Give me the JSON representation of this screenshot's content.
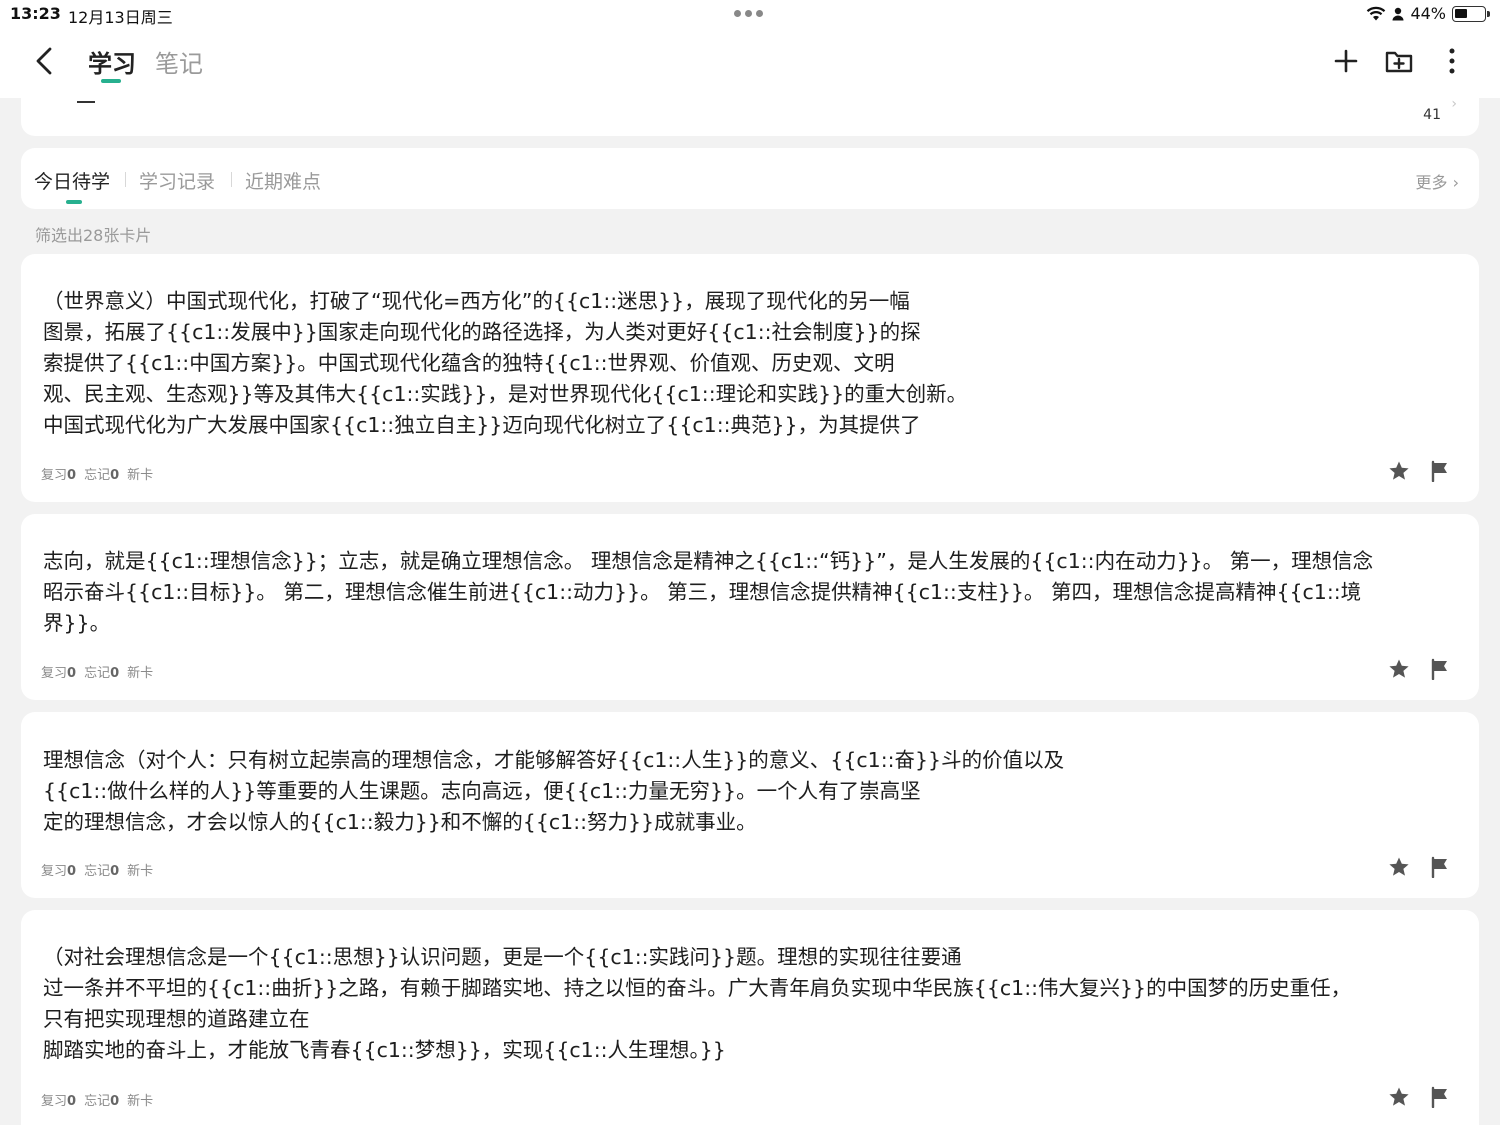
{
  "status_bar": {
    "time": "13:23",
    "date": "12月13日周三",
    "battery": "44%",
    "battery_level": 0.44
  },
  "header": {
    "tab_active": "学习",
    "tab_inactive": "笔记",
    "icons": [
      "back-icon",
      "plus-icon",
      "add-folder-icon",
      "more-vertical-icon"
    ]
  },
  "top_card": {
    "count": "41"
  },
  "segments": {
    "tabs": [
      "今日待学",
      "学习记录",
      "近期难点"
    ],
    "more": "更多 ›"
  },
  "filter_text": "筛选出28张卡片",
  "cards": [
    {
      "text": "（世界意义）中国式现代化，打破了“现代化=西方化”的{{c1::迷思}}，展现了现代化的另一幅\n图景，拓展了{{c1::发展中}}国家走向现代化的路径选择，为人类对更好{{c1::社会制度}}的探\n索提供了{{c1::中国方案}}。中国式现代化蕴含的独特{{c1::世界观、价值观、历史观、文明\n观、民主观、生态观}}等及其伟大{{c1::实践}}，是对世界现代化{{c1::理论和实践}}的重大创新。\n中国式现代化为广大发展中国家{{c1::独立自主}}迈向现代化树立了{{c1::典范}}，为其提供了",
      "review_label": "复习",
      "review_count": "0",
      "forget_label": "忘记",
      "forget_count": "0",
      "status": "新卡"
    },
    {
      "text": "志向，就是{{c1::理想信念}}；立志，就是确立理想信念。 理想信念是精神之{{c1::“钙}}”，是人生发展的{{c1::内在动力}}。 第一，理想信念\n昭示奋斗{{c1::目标}}。 第二，理想信念催生前进{{c1::动力}}。 第三，理想信念提供精神{{c1::支柱}}。 第四，理想信念提高精神{{c1::境\n界}}。",
      "review_label": "复习",
      "review_count": "0",
      "forget_label": "忘记",
      "forget_count": "0",
      "status": "新卡"
    },
    {
      "text": "理想信念（对个人：只有树立起崇高的理想信念，才能够解答好{{c1::人生}}的意义、{{c1::奋}}斗的价值以及\n{{c1::做什么样的人}}等重要的人生课题。志向高远，便{{c1::力量无穷}}。一个人有了崇高坚\n定的理想信念，才会以惊人的{{c1::毅力}}和不懈的{{c1::努力}}成就事业。",
      "review_label": "复习",
      "review_count": "0",
      "forget_label": "忘记",
      "forget_count": "0",
      "status": "新卡"
    },
    {
      "text": "（对社会理想信念是一个{{c1::思想}}认识问题，更是一个{{c1::实践问}}题。理想的实现往往要通\n过一条并不平坦的{{c1::曲折}}之路，有赖于脚踏实地、持之以恒的奋斗。广大青年肩负实现中华民族{{c1::伟大复兴}}的中国梦的历史重任，\n只有把实现理想的道路建立在\n脚踏实地的奋斗上，才能放飞青春{{c1::梦想}}，实现{{c1::人生理想。}}",
      "review_label": "复习",
      "review_count": "0",
      "forget_label": "忘记",
      "forget_count": "0",
      "status": "新卡"
    }
  ],
  "colors": {
    "accent": "#27b08f",
    "background": "#f2f2f2",
    "card": "#ffffff",
    "muted_text": "#9a9a9a",
    "icon": "#555555"
  }
}
